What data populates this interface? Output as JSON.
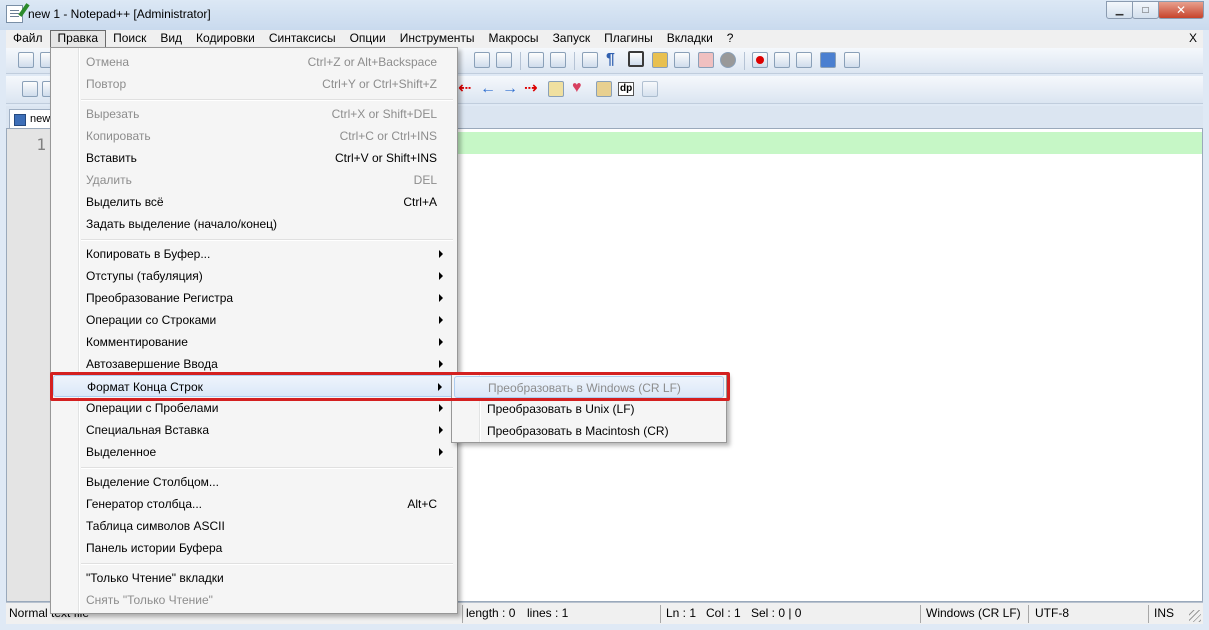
{
  "window": {
    "title": "new 1 - Notepad++ [Administrator]",
    "controls": {
      "minimize": "▁",
      "maximize": "□",
      "close": "✕"
    }
  },
  "menubar": {
    "items": [
      "Файл",
      "Правка",
      "Поиск",
      "Вид",
      "Кодировки",
      "Синтаксисы",
      "Опции",
      "Инструменты",
      "Макросы",
      "Запуск",
      "Плагины",
      "Вкладки",
      "?"
    ],
    "open_index": 1,
    "close_x": "X"
  },
  "toolbar": {
    "dp_label": "dp"
  },
  "tab": {
    "label": "new"
  },
  "editor": {
    "line_number": "1"
  },
  "edit_menu": {
    "undo": {
      "label": "Отмена",
      "shortcut": "Ctrl+Z or Alt+Backspace"
    },
    "redo": {
      "label": "Повтор",
      "shortcut": "Ctrl+Y or Ctrl+Shift+Z"
    },
    "cut": {
      "label": "Вырезать",
      "shortcut": "Ctrl+X or Shift+DEL"
    },
    "copy": {
      "label": "Копировать",
      "shortcut": "Ctrl+C or Ctrl+INS"
    },
    "paste": {
      "label": "Вставить",
      "shortcut": "Ctrl+V or Shift+INS"
    },
    "delete": {
      "label": "Удалить",
      "shortcut": "DEL"
    },
    "select_all": {
      "label": "Выделить всё",
      "shortcut": "Ctrl+A"
    },
    "set_selection": {
      "label": "Задать выделение (начало/конец)"
    },
    "copy_to_clipboard": {
      "label": "Копировать в Буфер..."
    },
    "indent": {
      "label": "Отступы (табуляция)"
    },
    "convert_case": {
      "label": "Преобразование Регистра"
    },
    "line_operations": {
      "label": "Операции со Строками"
    },
    "comment": {
      "label": "Комментирование"
    },
    "auto_completion": {
      "label": "Автозавершение Ввода"
    },
    "eol_conversion": {
      "label": "Формат Конца Строк"
    },
    "blank_operations": {
      "label": "Операции с Пробелами"
    },
    "paste_special": {
      "label": "Специальная Вставка"
    },
    "on_selection": {
      "label": "Выделенное"
    },
    "column_mode": {
      "label": "Выделение Столбцом..."
    },
    "column_editor": {
      "label": "Генератор столбца...",
      "shortcut": "Alt+C"
    },
    "ascii_table": {
      "label": "Таблица символов ASCII"
    },
    "clipboard_history": {
      "label": "Панель истории Буфера"
    },
    "read_only_tab": {
      "label": "\"Только Чтение\" вкладки"
    },
    "clear_read_only": {
      "label": "Снять \"Только Чтение\""
    }
  },
  "eol_submenu": {
    "windows": "Преобразовать в Windows (CR LF)",
    "unix": "Преобразовать в Unix (LF)",
    "mac": "Преобразовать в Macintosh (CR)"
  },
  "statusbar": {
    "file_type": "Normal text file",
    "length": "length : 0",
    "lines": "lines : 1",
    "ln": "Ln : 1",
    "col": "Col : 1",
    "sel": "Sel : 0 | 0",
    "eol": "Windows (CR LF)",
    "encoding": "UTF-8",
    "mode": "INS"
  }
}
